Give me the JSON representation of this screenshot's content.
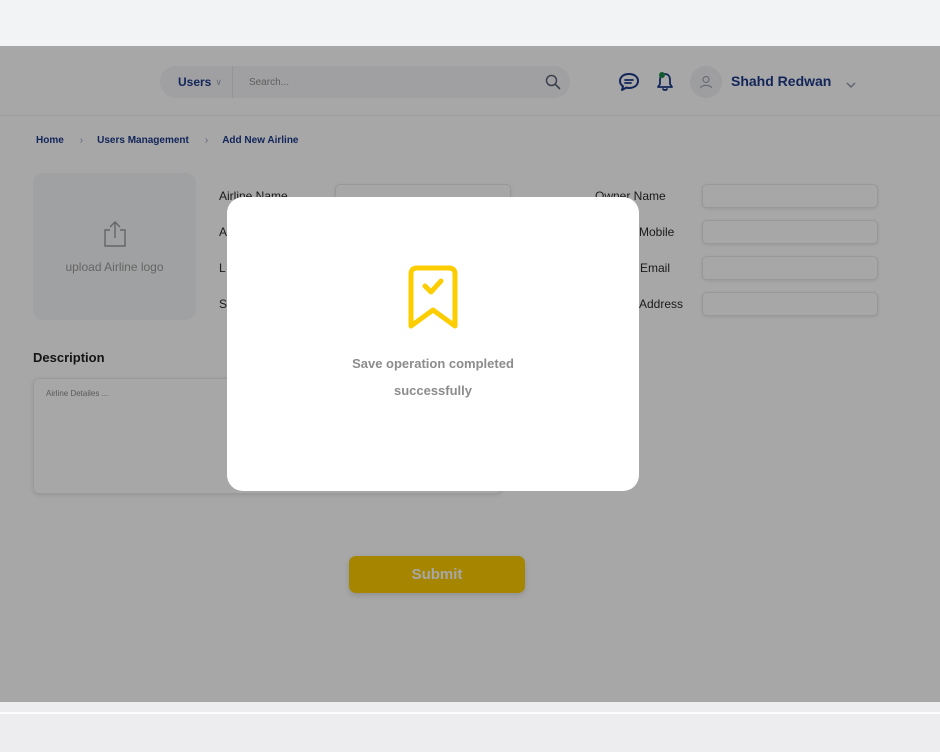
{
  "header": {
    "search": {
      "scope_label": "Users",
      "placeholder": "Search..."
    },
    "icons": {
      "chat": "chat-bubble-icon",
      "notifications": "bell-icon",
      "avatar": "user-icon",
      "search": "search-icon"
    },
    "user_name": "Shahd Redwan"
  },
  "breadcrumb": [
    "Home",
    "Users Management",
    "Add New Airline"
  ],
  "upload": {
    "label": "upload Airline logo",
    "icon": "upload-icon"
  },
  "form": {
    "left_fields": [
      {
        "label": "Airline Name",
        "value": ""
      },
      {
        "label": "A",
        "value": ""
      },
      {
        "label": "L",
        "value": ""
      },
      {
        "label": "S",
        "value": ""
      }
    ],
    "right_fields": [
      {
        "label": "Owner Name",
        "value": ""
      },
      {
        "label": "Mobile",
        "value": ""
      },
      {
        "label": "Email",
        "value": ""
      },
      {
        "label": "Address",
        "value": ""
      }
    ],
    "description": {
      "title": "Description",
      "placeholder": "Airline Detailes ..."
    },
    "submit_label": "Submit"
  },
  "modal": {
    "icon": "bookmark-check-icon",
    "message": "Save operation completed successfully"
  },
  "colors": {
    "brand_blue": "#1d3a8a",
    "accent_yellow": "#fdcd00",
    "icon_green": "#1d8a4a"
  }
}
